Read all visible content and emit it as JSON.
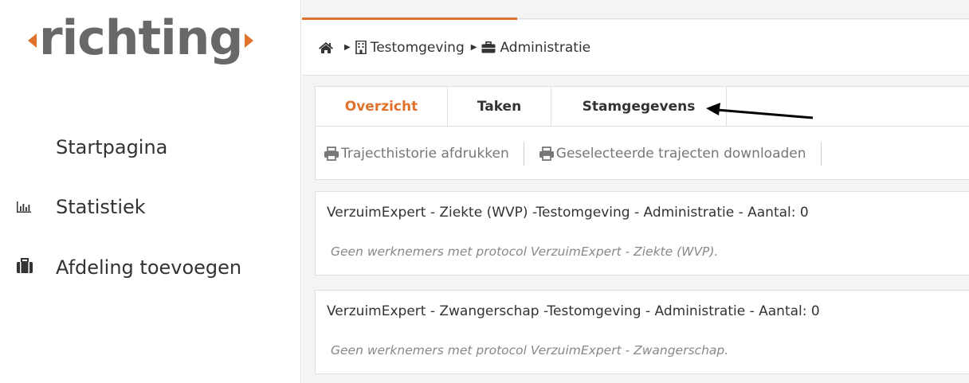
{
  "brand": {
    "logo_text": "richting",
    "accent_color": "#e0722b"
  },
  "sidebar": {
    "items": [
      {
        "label": "Startpagina",
        "icon": "none"
      },
      {
        "label": "Statistiek",
        "icon": "bar-chart-icon"
      },
      {
        "label": "Afdeling toevoegen",
        "icon": "briefcase-icon"
      }
    ]
  },
  "breadcrumb": {
    "home_icon": "home-icon",
    "items": [
      {
        "label": "Testomgeving",
        "icon": "building-icon"
      },
      {
        "label": "Administratie",
        "icon": "briefcase-icon"
      }
    ]
  },
  "tabs": [
    {
      "label": "Overzicht",
      "active": true
    },
    {
      "label": "Taken",
      "active": false
    },
    {
      "label": "Stamgegevens",
      "active": false
    }
  ],
  "toolbar": {
    "print_history_label": "Trajecthistorie afdrukken",
    "download_label": "Geselecteerde trajecten downloaden"
  },
  "protocols": [
    {
      "title": "VerzuimExpert - Ziekte (WVP)  -Testomgeving - Administratie - Aantal: 0",
      "empty_message": "Geen werknemers met protocol VerzuimExpert - Ziekte (WVP)."
    },
    {
      "title": "VerzuimExpert - Zwangerschap  -Testomgeving - Administratie - Aantal: 0",
      "empty_message": "Geen werknemers met protocol VerzuimExpert - Zwangerschap."
    }
  ]
}
